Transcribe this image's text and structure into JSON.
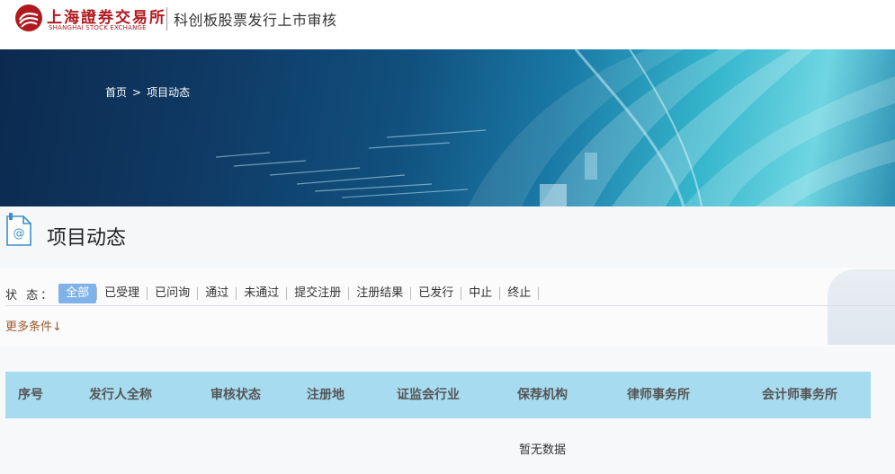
{
  "header": {
    "logo_cn": "上海證券交易所",
    "logo_en": "SHANGHAI STOCK EXCHANGE",
    "site_title": "科创板股票发行上市审核",
    "brand_color": "#b01a1f"
  },
  "breadcrumb": {
    "home": "首页",
    "separator": ">",
    "current": "项目动态"
  },
  "page": {
    "title": "项目动态",
    "title_icon": "document-at-icon"
  },
  "filters": {
    "status_label": "状  态：",
    "status_items": [
      "全部",
      "已受理",
      "已问询",
      "通过",
      "未通过",
      "提交注册",
      "注册结果",
      "已发行",
      "中止",
      "终止"
    ],
    "active_status": "全部",
    "more_label": "更多条件↓",
    "active_color": "#7fb2e8"
  },
  "table": {
    "columns": [
      "序号",
      "发行人全称",
      "审核状态",
      "注册地",
      "证监会行业",
      "保荐机构",
      "律师事务所",
      "会计师事务所"
    ],
    "empty_text": "暂无数据",
    "header_color": "#a7dcf0"
  }
}
